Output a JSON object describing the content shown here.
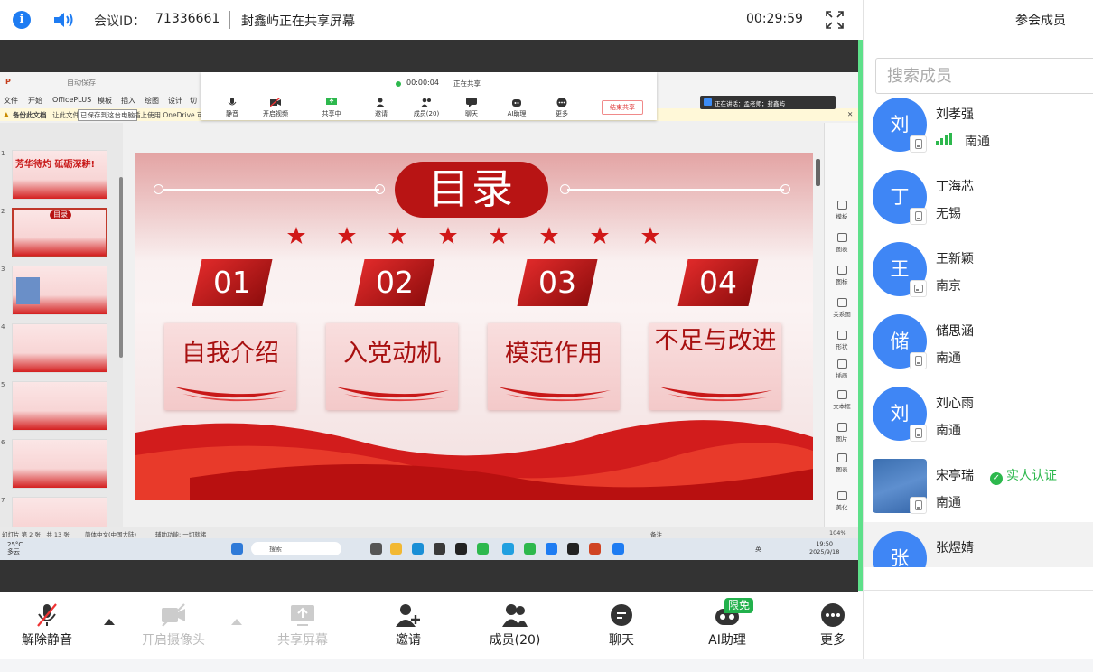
{
  "topbar": {
    "meeting_id_label": "会议ID：",
    "meeting_id": "71336661",
    "share_status": "封鑫屿正在共享屏幕",
    "elapsed": "00:29:59"
  },
  "shared_screen": {
    "ppt_menus": [
      "文件",
      "开始",
      "OfficePLUS",
      "模板",
      "插入",
      "绘图",
      "设计",
      "切"
    ],
    "ppt_autosave": "自动保存",
    "ppt_notice": "备份此文档",
    "ppt_notice_text": "让此文件",
    "ppt_notice_tooltip": "已保存到这台电脑",
    "ppt_notice_tail": "插上使用 OneDrive 可用",
    "share_toolbar": {
      "time": "00:00:04",
      "state": "正在共享",
      "buttons": [
        "静音",
        "开启视频",
        "共享中",
        "邀请",
        "成员(20)",
        "聊天",
        "AI助理",
        "更多"
      ],
      "end_label": "结束共享"
    },
    "speaking": "正在讲话：孟老师；封鑫屿",
    "slide": {
      "title": "目录",
      "items": [
        {
          "num": "01",
          "label": "自我介绍"
        },
        {
          "num": "02",
          "label": "入党动机"
        },
        {
          "num": "03",
          "label": "模范作用"
        },
        {
          "num": "04",
          "label": "不足与改进"
        }
      ]
    },
    "thumbs": {
      "numbers": [
        "1",
        "2",
        "3",
        "4",
        "5",
        "6",
        "7"
      ],
      "first_caption": "芳华待灼 砥砺深耕!",
      "second_caption": "目录"
    },
    "tools": [
      "模板",
      "图表",
      "图标",
      "关系图",
      "形状",
      "插画",
      "文本框",
      "图片",
      "图表",
      "美化"
    ],
    "status": {
      "slide_info": "幻灯片 第 2 张，共 13 张",
      "language": "简体中文(中国大陆)",
      "accessibility": "辅助功能: 一切就绪",
      "notes": "备注",
      "zoom": "104%"
    },
    "taskbar": {
      "temp": "25°C",
      "weather": "多云",
      "search": "搜索",
      "ime": "英",
      "time": "19:50",
      "date": "2025/9/18"
    }
  },
  "bottombar": {
    "buttons": [
      {
        "label": "解除静音",
        "icon": "mic-muted-icon",
        "enabled": true
      },
      {
        "label": "开启摄像头",
        "icon": "camera-off-icon",
        "enabled": false
      },
      {
        "label": "共享屏幕",
        "icon": "share-screen-icon",
        "enabled": false
      },
      {
        "label": "邀请",
        "icon": "invite-icon",
        "enabled": true
      },
      {
        "label": "成员(20)",
        "icon": "members-icon",
        "enabled": true
      },
      {
        "label": "聊天",
        "icon": "chat-icon",
        "enabled": true
      },
      {
        "label": "AI助理",
        "icon": "ai-assistant-icon",
        "enabled": true
      },
      {
        "label": "更多",
        "icon": "more-icon",
        "enabled": true
      }
    ],
    "ai_badge": "限免"
  },
  "panel": {
    "title": "参会成员",
    "search_placeholder": "搜索成员",
    "members": [
      {
        "avatar": "刘",
        "name": "刘孝强",
        "location": "南通",
        "signal": true
      },
      {
        "avatar": "丁",
        "name": "丁海芯",
        "location": "无锡"
      },
      {
        "avatar": "王",
        "name": "王新颖",
        "location": "南京"
      },
      {
        "avatar": "储",
        "name": "储思涵",
        "location": "南通"
      },
      {
        "avatar": "刘",
        "name": "刘心雨",
        "location": "南通"
      },
      {
        "avatar": "",
        "name": "宋亭瑞",
        "location": "南通",
        "verified": "实人认证"
      },
      {
        "avatar": "张",
        "name": "张煜婧",
        "location": ""
      }
    ]
  },
  "colors": {
    "accent_green": "#5ee08a",
    "avatar_blue": "#3f86f5",
    "slide_red": "#b81414",
    "verified_green": "#2db84d"
  }
}
